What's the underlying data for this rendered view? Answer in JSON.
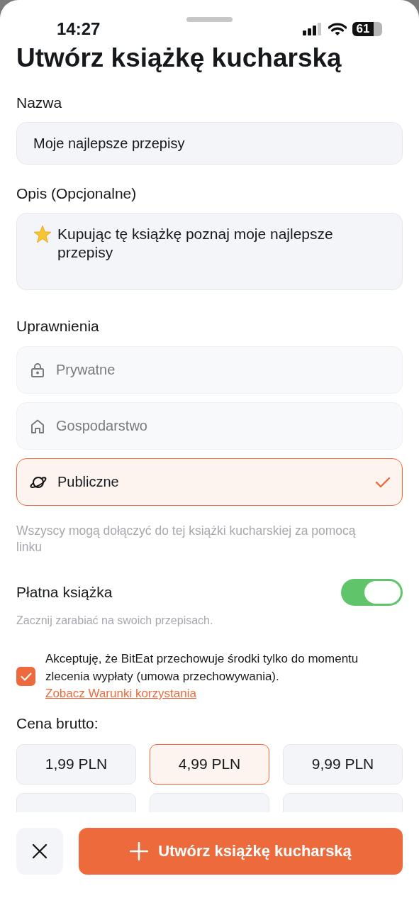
{
  "status_bar": {
    "time": "14:27",
    "battery": "61"
  },
  "title": "Utwórz książkę kucharską",
  "name_field": {
    "label": "Nazwa",
    "value": "Moje najlepsze przepisy"
  },
  "description_field": {
    "label": "Opis (Opcjonalne)",
    "value": "Kupując tę książkę poznaj moje najlepsze przepisy"
  },
  "permissions": {
    "label": "Uprawnienia",
    "options": [
      {
        "kind": "lock",
        "label": "Prywatne",
        "selected": false
      },
      {
        "kind": "house",
        "label": "Gospodarstwo",
        "selected": false
      },
      {
        "kind": "planet",
        "label": "Publiczne",
        "selected": true
      }
    ],
    "hint": "Wszyscy mogą dołączyć do tej książki kucharskiej za pomocą linku"
  },
  "paid_book": {
    "label": "Płatna książka",
    "on": true,
    "subtitle": "Zacznij zarabiać na swoich przepisach."
  },
  "consent": {
    "checked": true,
    "text": "Akceptuję, że BitEat przechowuje środki tylko do momentu zlecenia wypłaty (umowa przechowywania).",
    "link": "Zobacz Warunki korzystania"
  },
  "price": {
    "label": "Cena brutto:",
    "options": [
      {
        "label": "1,99 PLN",
        "selected": false
      },
      {
        "label": "4,99 PLN",
        "selected": true
      },
      {
        "label": "9,99 PLN",
        "selected": false
      }
    ]
  },
  "footer": {
    "create_button": "Utwórz książkę kucharską"
  }
}
